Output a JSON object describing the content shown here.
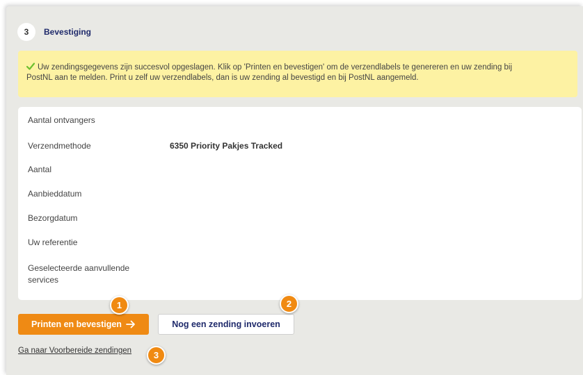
{
  "step": {
    "number": "3",
    "title": "Bevestiging"
  },
  "success": {
    "icon": "check-icon",
    "line1": "Uw zendingsgegevens zijn succesvol opgeslagen. Klik op 'Printen en bevestigen' om de verzendlabels te genereren en uw zending bij",
    "line2": "PostNL aan te melden. Print u zelf uw verzendlabels, dan is uw zending al bevestigd en bij PostNL aangemeld."
  },
  "details": {
    "rows": [
      {
        "label": "Aantal ontvangers",
        "value": ""
      },
      {
        "label": "Verzendmethode",
        "value": "6350 Priority Pakjes Tracked"
      },
      {
        "label": "Aantal",
        "value": ""
      },
      {
        "label": "Aanbieddatum",
        "value": ""
      },
      {
        "label": "Bezorgdatum",
        "value": ""
      },
      {
        "label": "Uw referentie",
        "value": ""
      },
      {
        "label_line1": "Geselecteerde aanvullende",
        "label_line2": "services",
        "value": ""
      }
    ]
  },
  "actions": {
    "primary_label": "Printen en bevestigen",
    "secondary_label": "Nog een zending invoeren",
    "link_label": "Ga naar Voorbereide zendingen"
  },
  "callouts": [
    "1",
    "2",
    "3"
  ],
  "colors": {
    "primary": "#ef8a14",
    "navy": "#1f2a6b",
    "success_bg": "#fdf2a3",
    "check": "#6cbf2e"
  }
}
